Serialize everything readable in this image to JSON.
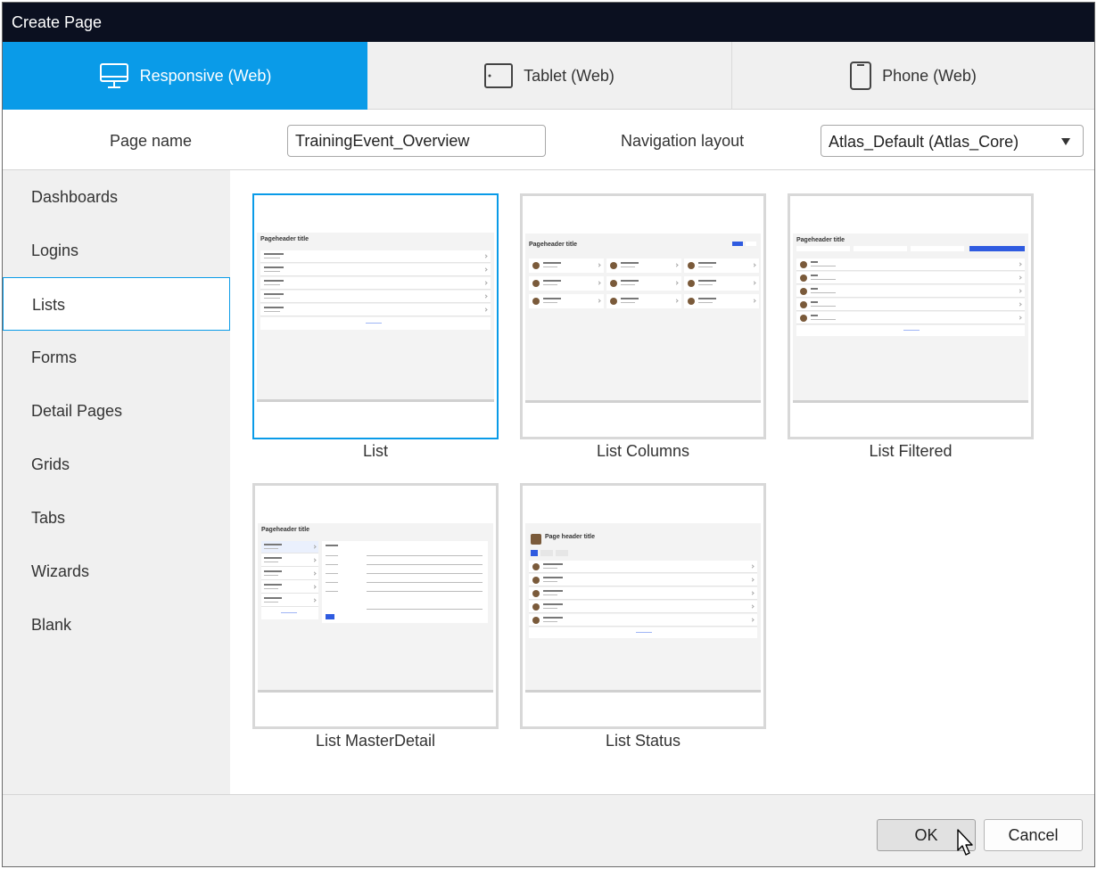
{
  "window": {
    "title": "Create Page"
  },
  "device_tabs": [
    {
      "label": "Responsive (Web)",
      "icon": "monitor-icon",
      "active": true
    },
    {
      "label": "Tablet (Web)",
      "icon": "tablet-icon",
      "active": false
    },
    {
      "label": "Phone (Web)",
      "icon": "phone-icon",
      "active": false
    }
  ],
  "form": {
    "page_name_label": "Page name",
    "page_name_value": "TrainingEvent_Overview",
    "nav_layout_label": "Navigation layout",
    "nav_layout_value": "Atlas_Default (Atlas_Core)"
  },
  "categories": [
    {
      "label": "Dashboards",
      "active": false
    },
    {
      "label": "Logins",
      "active": false
    },
    {
      "label": "Lists",
      "active": true
    },
    {
      "label": "Forms",
      "active": false
    },
    {
      "label": "Detail Pages",
      "active": false
    },
    {
      "label": "Grids",
      "active": false
    },
    {
      "label": "Tabs",
      "active": false
    },
    {
      "label": "Wizards",
      "active": false
    },
    {
      "label": "Blank",
      "active": false
    }
  ],
  "templates": [
    {
      "label": "List",
      "selected": true,
      "preview_title": "Pageheader title"
    },
    {
      "label": "List Columns",
      "selected": false,
      "preview_title": "Pageheader title"
    },
    {
      "label": "List Filtered",
      "selected": false,
      "preview_title": "Pageheader title"
    },
    {
      "label": "List MasterDetail",
      "selected": false,
      "preview_title": "Pageheader title"
    },
    {
      "label": "List Status",
      "selected": false,
      "preview_title": "Page header title"
    }
  ],
  "footer": {
    "ok_label": "OK",
    "cancel_label": "Cancel"
  },
  "colors": {
    "accent": "#0a9be8",
    "titlebar": "#0b1020",
    "panel": "#f0f0f0",
    "preview_button": "#2f5be0"
  }
}
